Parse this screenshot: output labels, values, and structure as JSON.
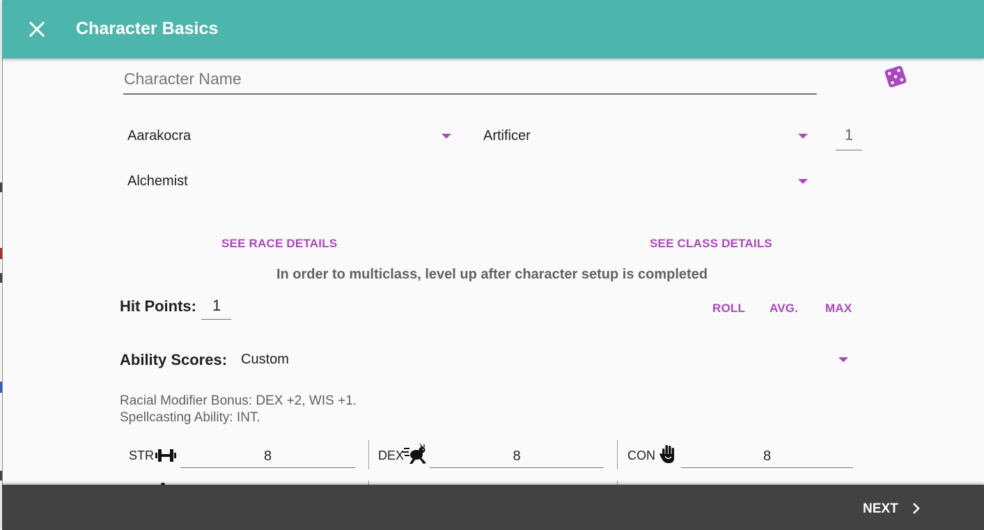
{
  "appbar": {
    "title": "Character Basics",
    "close_icon": "close-icon",
    "color": "#4db6ac"
  },
  "form": {
    "character_name": {
      "placeholder": "Character Name",
      "value": ""
    },
    "randomize_icon": "dice-icon",
    "race": {
      "value": "Aarakocra"
    },
    "class": {
      "value": "Artificer"
    },
    "level": {
      "value": "1"
    },
    "subclass": {
      "value": "Alchemist"
    },
    "see_race_details": "SEE RACE DETAILS",
    "see_class_details": "SEE CLASS DETAILS",
    "multiclass_notice": "In order to multiclass, level up after character setup is completed"
  },
  "hit_points": {
    "label": "Hit Points:",
    "value": "1",
    "roll_label": "ROLL",
    "avg_label": "AVG.",
    "max_label": "MAX"
  },
  "ability_scores": {
    "label": "Ability Scores:",
    "method": "Custom",
    "racial_bonus": "Racial Modifier Bonus: DEX +2, WIS +1.",
    "spellcasting": "Spellcasting Ability: INT.",
    "scores": [
      {
        "abbr": "STR",
        "icon": "dumbbell-icon",
        "value": "8"
      },
      {
        "abbr": "DEX",
        "icon": "running-rabbit-icon",
        "value": "8"
      },
      {
        "abbr": "CON",
        "icon": "hand-icon",
        "value": "8"
      }
    ]
  },
  "footer": {
    "next_label": "NEXT",
    "next_icon": "chevron-right-icon",
    "color": "#424242"
  },
  "colors": {
    "accent": "#ab47bc",
    "background": "#fafafa"
  }
}
